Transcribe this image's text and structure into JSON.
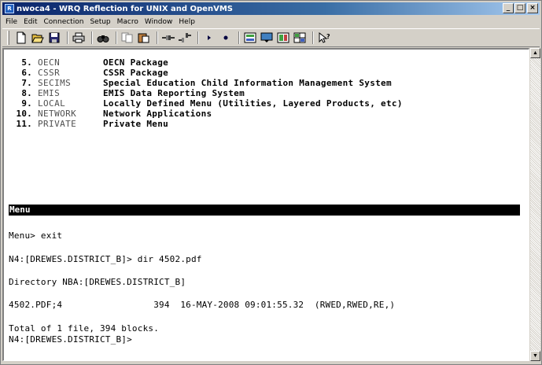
{
  "window": {
    "title": "nwoca4 - WRQ Reflection for UNIX and OpenVMS",
    "icon_text": "R"
  },
  "menubar": [
    "File",
    "Edit",
    "Connection",
    "Setup",
    "Macro",
    "Window",
    "Help"
  ],
  "toolbar": {
    "icons": [
      "new-icon",
      "open-icon",
      "save-icon",
      "print-icon",
      "find-icon",
      "copy-icon",
      "paste-icon",
      "connect-icon",
      "disconnect-icon",
      "play-icon",
      "record-icon",
      "settings-icon",
      "keyboard-icon",
      "mouse-icon",
      "display-icon",
      "help-pointer-icon"
    ]
  },
  "terminal": {
    "menu_items": [
      {
        "num": "5.",
        "key": "OECN",
        "desc": "OECN Package"
      },
      {
        "num": "6.",
        "key": "CSSR",
        "desc": "CSSR Package"
      },
      {
        "num": "7.",
        "key": "SECIMS",
        "desc": "Special Education Child Information Management System"
      },
      {
        "num": "8.",
        "key": "EMIS",
        "desc": "EMIS Data Reporting System"
      },
      {
        "num": "9.",
        "key": "LOCAL",
        "desc": "Locally Defined Menu (Utilities, Layered Products, etc)"
      },
      {
        "num": "10.",
        "key": "NETWORK",
        "desc": "Network Applications"
      },
      {
        "num": "11.",
        "key": "PRIVATE",
        "desc": "Private Menu"
      }
    ],
    "status_bar": "Menu",
    "lines": [
      "Menu> exit",
      "N4:[DREWES.DISTRICT_B]> dir 4502.pdf",
      "Directory NBA:[DREWES.DISTRICT_B]",
      "4502.PDF;4                 394  16-MAY-2008 09:01:55.32  (RWED,RWED,RE,)",
      "Total of 1 file, 394 blocks.",
      "N4:[DREWES.DISTRICT_B]>"
    ]
  },
  "colors": {
    "titlebar_start": "#0a246a",
    "titlebar_end": "#a6caf0",
    "status_bar_bg": "#000000",
    "terminal_bg": "#ffffff"
  }
}
